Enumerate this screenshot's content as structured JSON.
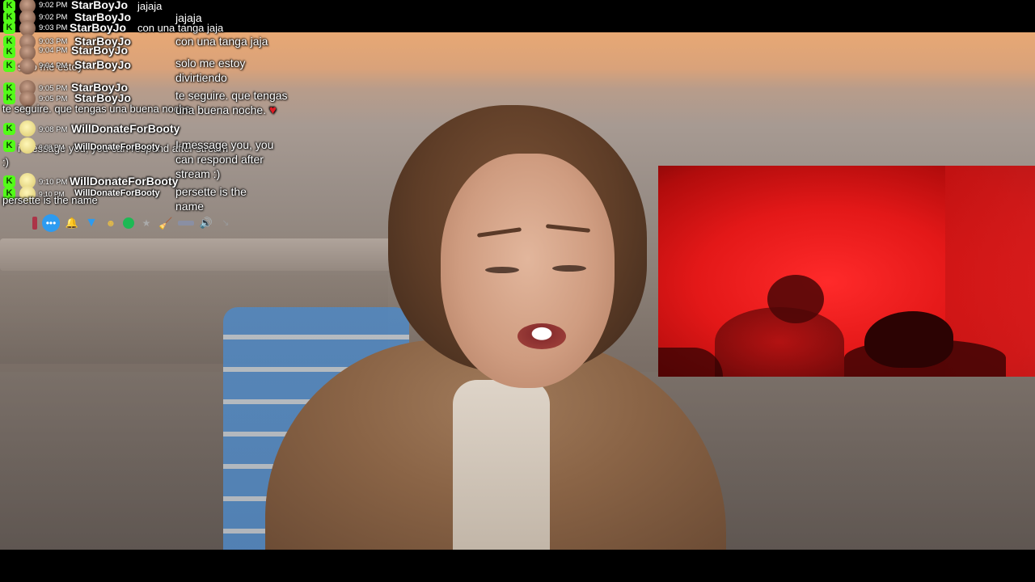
{
  "chat": {
    "rows": [
      {
        "time": "9:02 PM",
        "user": "StarBoyJo",
        "message": "jajaja"
      },
      {
        "time": "9:02 PM",
        "user": "StarBoyJo"
      },
      {
        "time": "9:03 PM",
        "user": "StarBoyJo",
        "message": "con una tanga jaja"
      },
      {
        "time": "9:03 PM",
        "user": "StarBoyJo"
      },
      {
        "time": "9:04 PM",
        "user": "StarBoyJo"
      },
      {
        "time": "9:04 PM",
        "user": "StarBoyJo",
        "message_overlap": "solo me estoy"
      },
      {
        "time": "9:05 PM",
        "user": "StarBoyJo"
      },
      {
        "time": "9:05 PM",
        "user": "StarBoyJo"
      },
      {
        "message_overlap": "te seguire. que tengas una buena noche."
      },
      {
        "time": "9:08 PM",
        "user": "WillDonateForBooty"
      },
      {
        "time": "9:08 PM",
        "user": "WillDonateForBooty",
        "message_overlap": "i message you, you can respond after stream"
      },
      {
        "message_overlap": ":)"
      },
      {
        "time": "9:10 PM",
        "user": "WillDonateForBooty"
      },
      {
        "time": "9:10 PM",
        "user": "WillDonateForBooty"
      },
      {
        "message_overlap": "persette is the name"
      }
    ],
    "column": {
      "m1": "jajaja",
      "m2": "con una tanga jaja",
      "m3": "solo me estoy divirtiendo",
      "m4": "te seguire. que tengas una buena noche.",
      "m5": "I message you, you can respond after stream :)",
      "m6": "persette is the name"
    }
  },
  "toolbar": {
    "icons": [
      "pause-icon",
      "chat-bubble-icon",
      "bell-icon",
      "filter-icon",
      "emoji-icon",
      "spotify-icon",
      "star-icon",
      "broom-icon",
      "bar-icon",
      "speaker-icon",
      "arrow-icon"
    ],
    "glyphs": {
      "bubble": "•••",
      "bell": "🔔",
      "filter": "▼",
      "emoji": "☻",
      "star": "★",
      "broom": "🧹",
      "speaker": "🔊",
      "arrow": "↘"
    }
  },
  "colors": {
    "kick_green": "#53fc18",
    "pip_red": "#e31818",
    "heart": "#e01b24"
  }
}
